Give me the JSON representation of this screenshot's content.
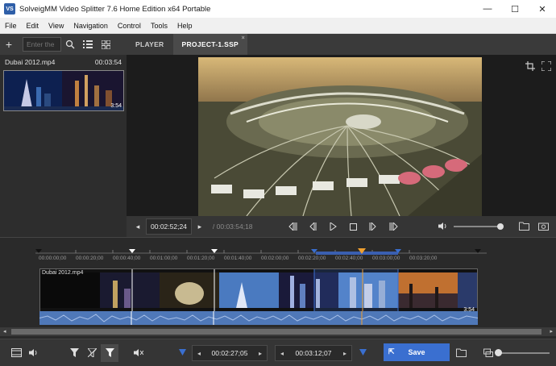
{
  "window": {
    "app_icon_text": "VS",
    "title": "SolveigMM Video Splitter 7.6 Home Edition x64 Portable",
    "minimize": "—",
    "maximize": "☐",
    "close": "✕"
  },
  "menu": [
    "File",
    "Edit",
    "View",
    "Navigation",
    "Control",
    "Tools",
    "Help"
  ],
  "left_panel": {
    "add_label": "+",
    "search_placeholder": "Enter the",
    "file": {
      "name": "Dubai 2012.mp4",
      "duration": "00:03:54",
      "thumb_label": "3:54"
    }
  },
  "tabs": [
    {
      "label": "PLAYER",
      "active": false
    },
    {
      "label": "PROJECT-1.SSP",
      "active": true,
      "close": "×"
    }
  ],
  "transport": {
    "current_time": "00:02:52;24",
    "total_time": "/ 00:03:54;18",
    "volume_level": 0.9
  },
  "timeline": {
    "ticks": [
      "00:00:00;00",
      "00:00:20;00",
      "00:00:40;00",
      "00:01:00;00",
      "00:01:20;00",
      "00:01:40;00",
      "00:02:00;00",
      "00:02:20;00",
      "00:02:40;00",
      "00:03:00;00",
      "00:03:20;00"
    ],
    "clip_name": "Dubai 2012.mp4",
    "clip_duration": "3:54"
  },
  "bottom": {
    "start_time": "00:02:27;05",
    "end_time": "00:03:12;07",
    "save_label": "Save",
    "accent_color": "#3a6fd0",
    "marker_color": "#f0a030"
  }
}
